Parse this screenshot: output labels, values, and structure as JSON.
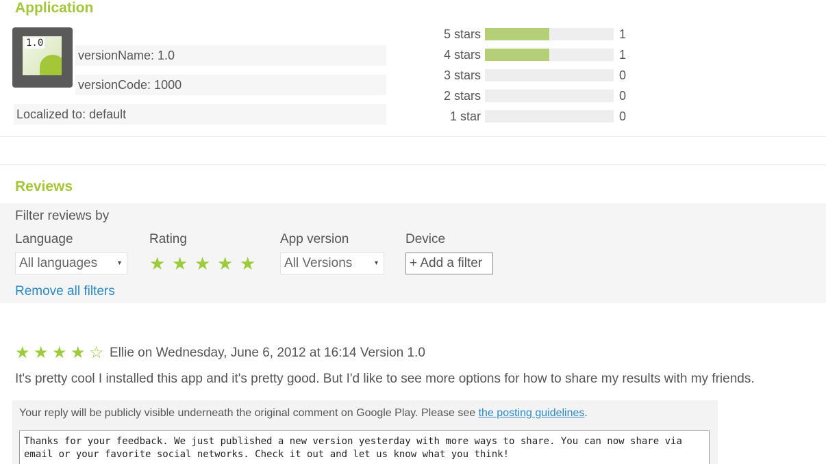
{
  "application": {
    "title": "Application",
    "icon_text": "1.0",
    "version_name": "versionName: 1.0",
    "version_code": "versionCode: 1000",
    "localized": "Localized to: default"
  },
  "ratings": [
    {
      "label": "5 stars",
      "count": "1",
      "fraction": 0.5
    },
    {
      "label": "4 stars",
      "count": "1",
      "fraction": 0.5
    },
    {
      "label": "3 stars",
      "count": "0",
      "fraction": 0
    },
    {
      "label": "2 stars",
      "count": "0",
      "fraction": 0
    },
    {
      "label": "1 star",
      "count": "0",
      "fraction": 0
    }
  ],
  "reviews": {
    "title": "Reviews",
    "filter_heading": "Filter reviews by",
    "language_label": "Language",
    "language_value": "All languages",
    "rating_label": "Rating",
    "rating_stars": 5,
    "app_version_label": "App version",
    "app_version_value": "All Versions",
    "device_label": "Device",
    "add_filter": "+ Add a filter",
    "remove_filters": "Remove all filters"
  },
  "review": {
    "stars_filled": 4,
    "stars_total": 5,
    "meta": "Ellie on Wednesday, June 6, 2012 at 16:14   Version 1.0",
    "body": "It's pretty cool I installed this app and it's pretty good. But I'd like to see more options for how to share my results with my friends."
  },
  "reply": {
    "note": "Your reply will be publicly visible underneath the original comment on Google Play. Please see ",
    "guidelines_link": "the posting guidelines",
    "note_end": ".",
    "text": "Thanks for your feedback. We just published a new version yesterday with more ways to share. You can now share via email or your favorite social networks. Check it out and let us know what you think!"
  },
  "colors": {
    "accent": "#a4c639",
    "star": "#9ccb3b",
    "bar_fill": "#b5cf79",
    "link": "#2a88c7"
  }
}
